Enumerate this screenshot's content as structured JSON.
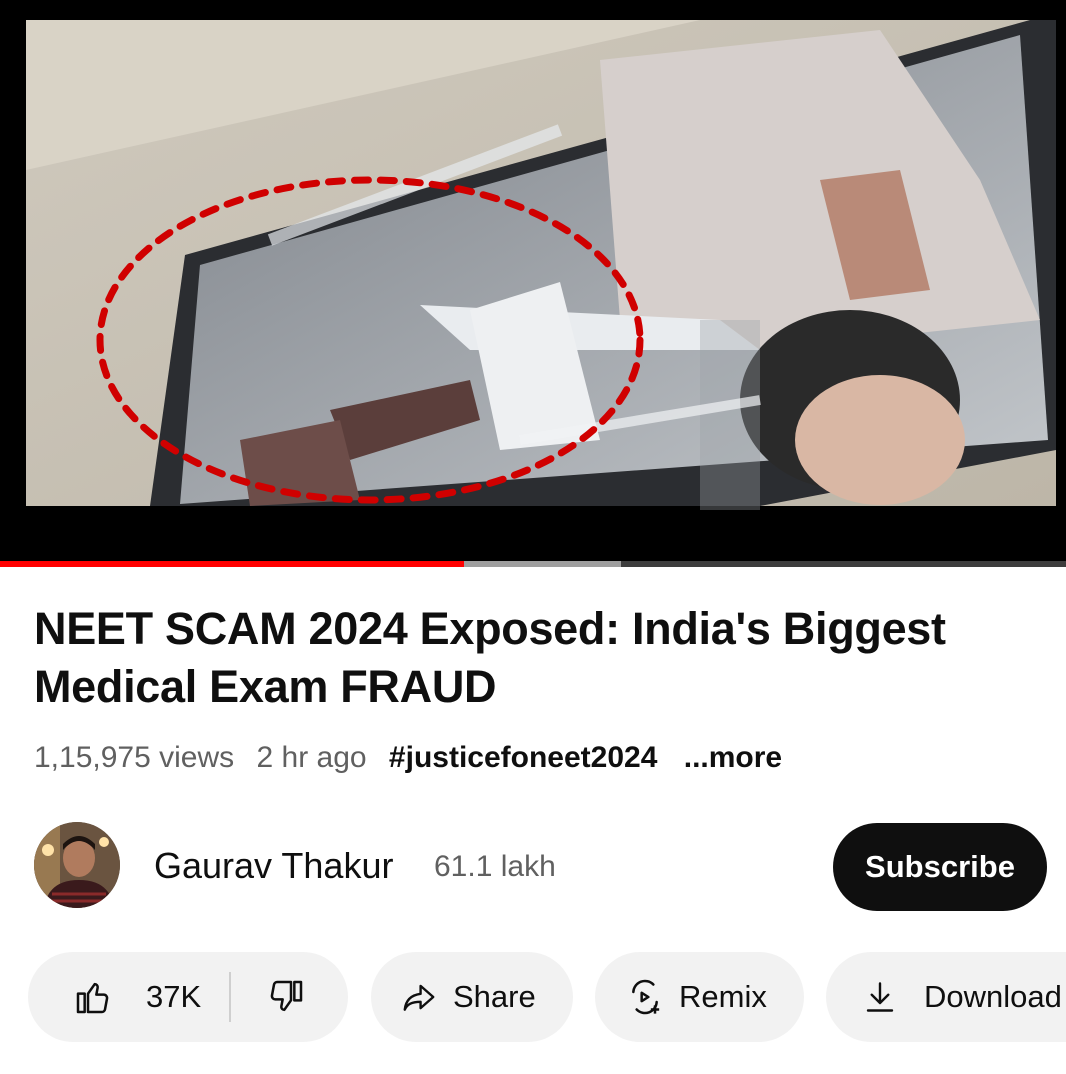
{
  "player": {
    "progress_played_fraction": 0.435,
    "progress_buffered_fraction": 0.583
  },
  "video": {
    "title": "NEET SCAM 2024 Exposed: India's Biggest Medical Exam FRAUD",
    "views": "1,15,975 views",
    "age": "2 hr ago",
    "hashtag": "#justicefoneet2024",
    "more_label": "...more"
  },
  "channel": {
    "name": "Gaurav Thakur",
    "subscribers": "61.1 lakh",
    "subscribe_label": "Subscribe"
  },
  "actions": {
    "like_count": "37K",
    "share_label": "Share",
    "remix_label": "Remix",
    "download_label": "Download"
  },
  "colors": {
    "accent": "#ff0000",
    "text_primary": "#0f0f0f",
    "text_secondary": "#606060",
    "pill_background": "#f2f2f2"
  },
  "icons": {
    "like": "thumbs-up-icon",
    "dislike": "thumbs-down-icon",
    "share": "share-arrow-icon",
    "remix": "remix-icon",
    "download": "download-icon"
  }
}
